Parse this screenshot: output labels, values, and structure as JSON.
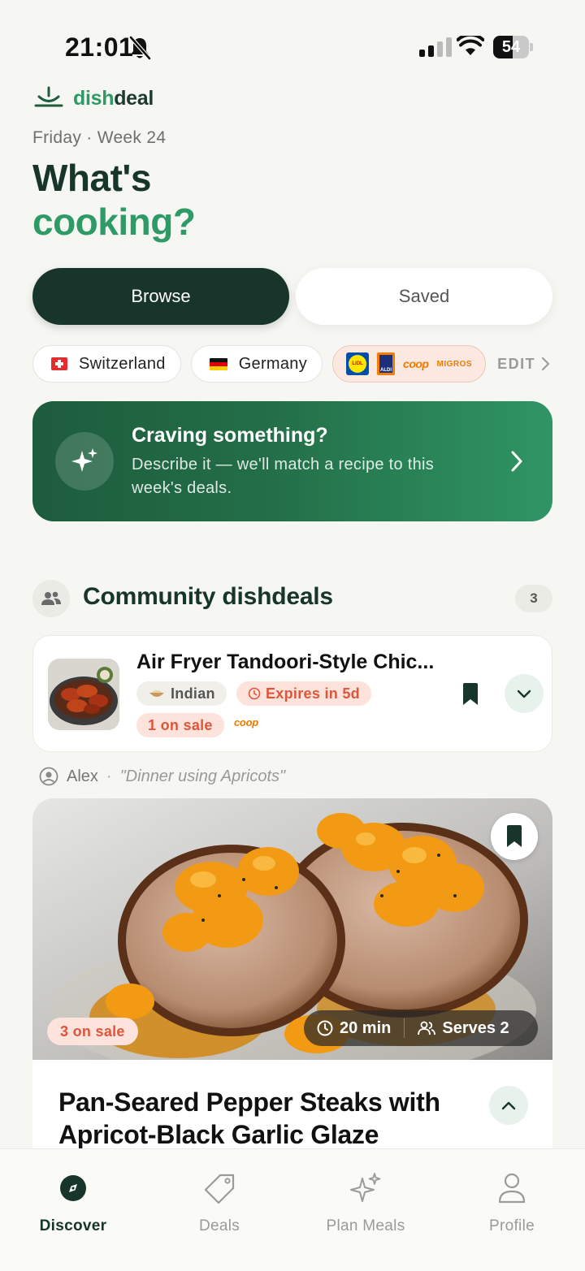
{
  "status": {
    "time": "21:01",
    "battery": "54",
    "battery_level": 0.54
  },
  "app": {
    "logo_part1": "dish",
    "logo_part2": "deal"
  },
  "header": {
    "date_line": "Friday · Week 24",
    "headline_line1": "What's",
    "headline_line2": "cooking?"
  },
  "tabs": [
    {
      "label": "Browse",
      "active": true
    },
    {
      "label": "Saved",
      "active": false
    }
  ],
  "filters": {
    "countries": [
      {
        "label": "Switzerland"
      },
      {
        "label": "Germany"
      }
    ],
    "stores": [
      {
        "name": "Lidl",
        "logo_text": "LiDL"
      },
      {
        "name": "Aldi",
        "logo_text": "ALDI"
      },
      {
        "name": "Coop",
        "logo_text": "coop"
      },
      {
        "name": "Migros",
        "logo_text": "MIGROS"
      }
    ],
    "edit_label": "EDIT"
  },
  "craving": {
    "title": "Craving something?",
    "description": "Describe it — we'll match a recipe to this week's deals."
  },
  "community": {
    "title": "Community dishdeals",
    "count": "3",
    "deal": {
      "title": "Air Fryer Tandoori-Style Chic...",
      "cuisine": "Indian",
      "expires": "Expires in 5d",
      "on_sale": "1 on sale",
      "store": "coop"
    }
  },
  "featured": {
    "author": "Alex",
    "request": "\"Dinner using Apricots\"",
    "on_sale": "3 on sale",
    "time": "20 min",
    "serves": "Serves 2",
    "title": "Pan-Seared Pepper Steaks with Apricot-Black Garlic Glaze"
  },
  "nav": [
    {
      "label": "Discover",
      "icon": "compass-icon",
      "active": true
    },
    {
      "label": "Deals",
      "icon": "tag-icon",
      "active": false
    },
    {
      "label": "Plan Meals",
      "icon": "sparkles-icon",
      "active": false
    },
    {
      "label": "Profile",
      "icon": "person-icon",
      "active": false
    }
  ],
  "colors": {
    "brand_dark": "#17352a",
    "brand_green": "#2e9a66",
    "sale_red": "#e0553a",
    "sale_bg": "#fde3dc"
  }
}
